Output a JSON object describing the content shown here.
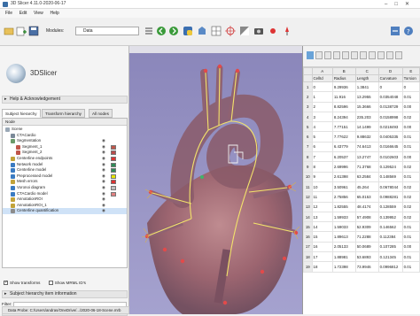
{
  "window": {
    "title": "3D Slicer 4.11.0-2020-06-17"
  },
  "menu": [
    "File",
    "Edit",
    "View",
    "Help"
  ],
  "toolbar": {
    "modules_label": "Modules:",
    "module_value": "Data"
  },
  "left": {
    "logo_text": "3DSlicer",
    "help_section": "Help & Acknowledgement",
    "tabs": [
      "Subject hierarchy",
      "Transform hierarchy",
      "All nodes"
    ],
    "tree_header": "Node",
    "tree": [
      {
        "label": "Scene",
        "indent": 0,
        "icon": "#9aa8b6",
        "swatch": ""
      },
      {
        "label": "CTACardio",
        "indent": 6,
        "icon": "#7b8a99",
        "swatch": ""
      },
      {
        "label": "Segmentation",
        "indent": 6,
        "icon": "#6a9a6a",
        "swatch": ""
      },
      {
        "label": "Segment_1",
        "indent": 12,
        "icon": "#c0564a",
        "swatch": "#c0564a"
      },
      {
        "label": "Segment_2",
        "indent": 12,
        "icon": "#c0564a",
        "swatch": "#b84b4b"
      },
      {
        "label": "Centerline endpoints",
        "indent": 6,
        "icon": "#c2a33a",
        "swatch": "#d33"
      },
      {
        "label": "Network model",
        "indent": 6,
        "icon": "#3a7bc2",
        "swatch": "#2e8b57"
      },
      {
        "label": "Centerline model",
        "indent": 6,
        "icon": "#3a7bc2",
        "swatch": "#2e8b57"
      },
      {
        "label": "Preprocessed model",
        "indent": 6,
        "icon": "#3a7bc2",
        "swatch": "#e6e600"
      },
      {
        "label": "Mesh errors",
        "indent": 6,
        "icon": "#c2a33a",
        "swatch": "#d33"
      },
      {
        "label": "Voronoi diagram",
        "indent": 6,
        "icon": "#3a7bc2",
        "swatch": "#c0c0c0"
      },
      {
        "label": "CTACardio model",
        "indent": 6,
        "icon": "#3a7bc2",
        "swatch": "#e08080"
      },
      {
        "label": "AnnotationROI",
        "indent": 6,
        "icon": "#c2a33a",
        "swatch": ""
      },
      {
        "label": "AnnotationROI_1",
        "indent": 6,
        "icon": "#c2a33a",
        "swatch": ""
      },
      {
        "label": "Centerline quantification",
        "indent": 6,
        "icon": "#8c8c8c",
        "swatch": ""
      }
    ],
    "show_transforms": "Show transforms",
    "show_mrml_ids": "Show MRML ID's",
    "subject_info": "Subject hierarchy item information",
    "filter_label": "Filter:",
    "mrml_info": "MRML node information",
    "data_probe": "Data Probe: C:/Users/andras/OneDrive/.../2020-06-18-Scene.mrb"
  },
  "table": {
    "columns": [
      "",
      "CellId",
      "Radius",
      "Length",
      "Curvature",
      "Torsion"
    ],
    "col_letters": [
      "",
      "A",
      "B",
      "C",
      "D",
      "E"
    ],
    "rows": [
      [
        "1",
        "0",
        "9.29936",
        "1.3841",
        "0",
        "0"
      ],
      [
        "2",
        "1",
        "11.916",
        "13.2955",
        "0.0354048",
        "0.01"
      ],
      [
        "3",
        "2",
        "8.82596",
        "15.3666",
        "0.0138729",
        "0.00"
      ],
      [
        "4",
        "3",
        "8.24394",
        "235.203",
        "0.0158998",
        "0.02"
      ],
      [
        "5",
        "4",
        "7.77151",
        "14.1499",
        "0.0218493",
        "0.00"
      ],
      [
        "6",
        "5",
        "7.77622",
        "9.88632",
        "0.0405335",
        "0.01"
      ],
      [
        "7",
        "6",
        "6.43779",
        "74.6413",
        "0.0166645",
        "0.01"
      ],
      [
        "8",
        "7",
        "6.20537",
        "13.2747",
        "0.0102603",
        "0.00"
      ],
      [
        "9",
        "8",
        "2.69996",
        "71.3768",
        "0.129524",
        "0.02"
      ],
      [
        "10",
        "9",
        "2.61398",
        "63.2584",
        "0.148569",
        "0.01"
      ],
      [
        "11",
        "10",
        "3.50961",
        "45.264",
        "0.0678044",
        "0.02"
      ],
      [
        "12",
        "11",
        "2.75856",
        "65.0153",
        "0.0988281",
        "0.02"
      ],
      [
        "13",
        "12",
        "1.82555",
        "48.4174",
        "0.128559",
        "0.02"
      ],
      [
        "14",
        "13",
        "1.59933",
        "57.4908",
        "0.139952",
        "0.02"
      ],
      [
        "15",
        "14",
        "1.59033",
        "52.9309",
        "0.146562",
        "0.01"
      ],
      [
        "16",
        "15",
        "1.89613",
        "71.2288",
        "0.112384",
        "0.01"
      ],
      [
        "17",
        "16",
        "2.05133",
        "50.0689",
        "0.107285",
        "0.00"
      ],
      [
        "18",
        "17",
        "1.88981",
        "53.6893",
        "0.121345",
        "0.01"
      ],
      [
        "19",
        "18",
        "1.72398",
        "73.9946",
        "0.0996812",
        "0.01"
      ]
    ]
  }
}
